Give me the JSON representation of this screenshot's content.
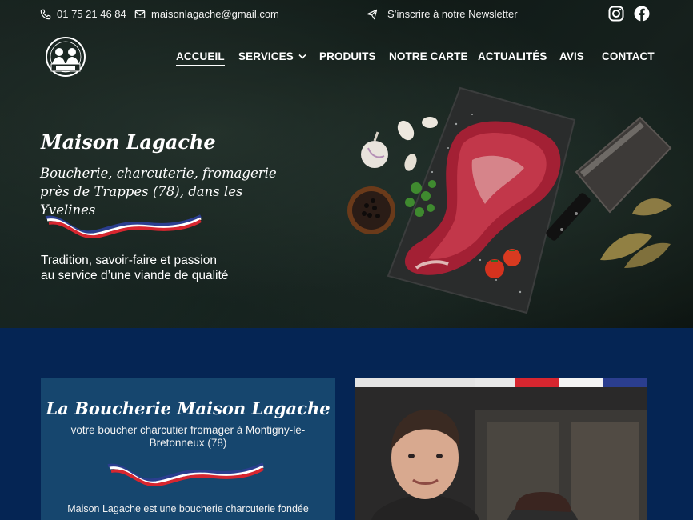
{
  "topbar": {
    "phone": "01 75 21 46 84",
    "email": "maisonlagache@gmail.com",
    "newsletter": "S’inscrire à notre Newsletter",
    "icons": [
      "phone-icon",
      "mail-icon",
      "paper-plane-icon",
      "instagram-icon",
      "facebook-icon"
    ]
  },
  "nav": {
    "items": [
      {
        "label": "ACCUEIL",
        "active": true
      },
      {
        "label": "SERVICES"
      },
      {
        "label": "PRODUITS"
      },
      {
        "label": "NOTRE CARTE"
      },
      {
        "label": "ACTUALITÉS"
      },
      {
        "label": "AVIS"
      },
      {
        "label": "CONTACT"
      }
    ]
  },
  "hero": {
    "title": "Maison Lagache",
    "subtitle_line1": "Boucherie, charcuterie, fromagerie",
    "subtitle_line2": "près de Trappes (78), dans les Yvelines",
    "tagline_line1": "Tradition, savoir-faire et passion",
    "tagline_line2": "au service d’une viande de qualité"
  },
  "about": {
    "title": "La Boucherie Maison Lagache",
    "subtitle": "votre boucher charcutier fromager à Montigny-le-Bretonneux (78)",
    "text": "Maison Lagache est une boucherie charcuterie fondée"
  },
  "colors": {
    "lower_bg": "#052554",
    "card_bg": "#16466e",
    "flag_blue": "#2b3e8f",
    "flag_red": "#d7262f"
  }
}
